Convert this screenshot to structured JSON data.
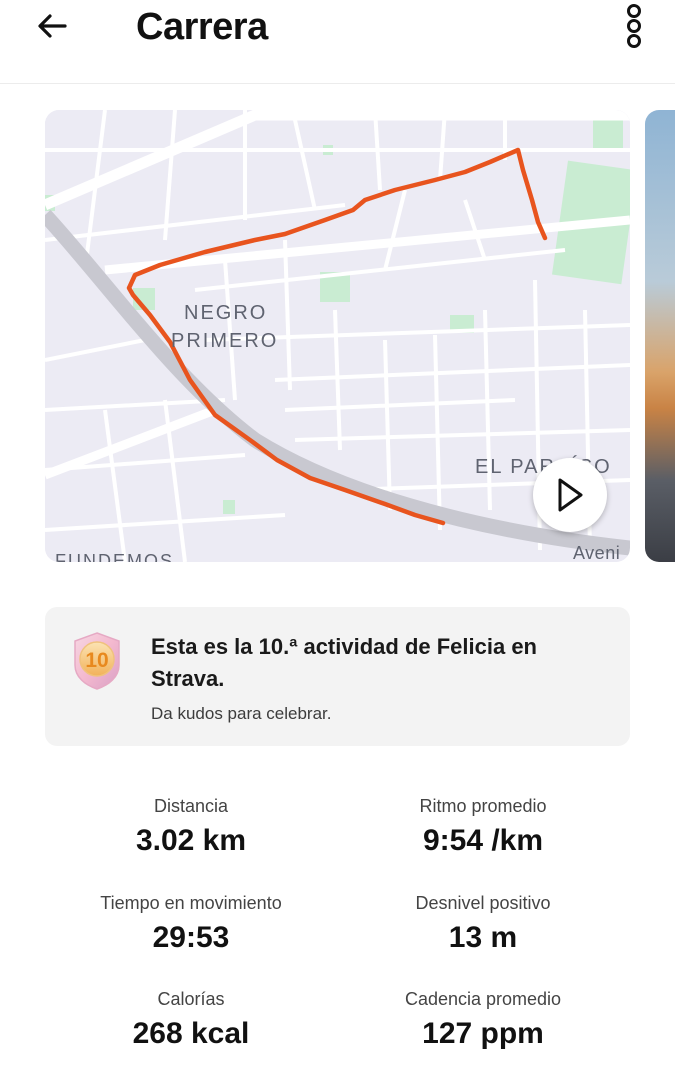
{
  "header": {
    "title": "Carrera",
    "back_icon": "arrow-left-icon",
    "more_icon": "more-vertical-icon"
  },
  "map": {
    "labels": [
      "NEGRO",
      "PRIMERO",
      "EL PARAÍSO",
      "FUNDEMOS",
      "Aveni"
    ],
    "route_color": "#e8541e",
    "play_icon": "play-icon"
  },
  "milestone": {
    "badge_text": "10",
    "title": "Esta es la 10.ª actividad de Felicia en Strava.",
    "subtitle": "Da kudos para celebrar."
  },
  "stats": [
    {
      "label": "Distancia",
      "value": "3.02 km"
    },
    {
      "label": "Ritmo promedio",
      "value": "9:54 /km"
    },
    {
      "label": "Tiempo en movimiento",
      "value": "29:53"
    },
    {
      "label": "Desnivel positivo",
      "value": "13 m"
    },
    {
      "label": "Calorías",
      "value": "268 kcal"
    },
    {
      "label": "Cadencia promedio",
      "value": "127 ppm"
    }
  ]
}
